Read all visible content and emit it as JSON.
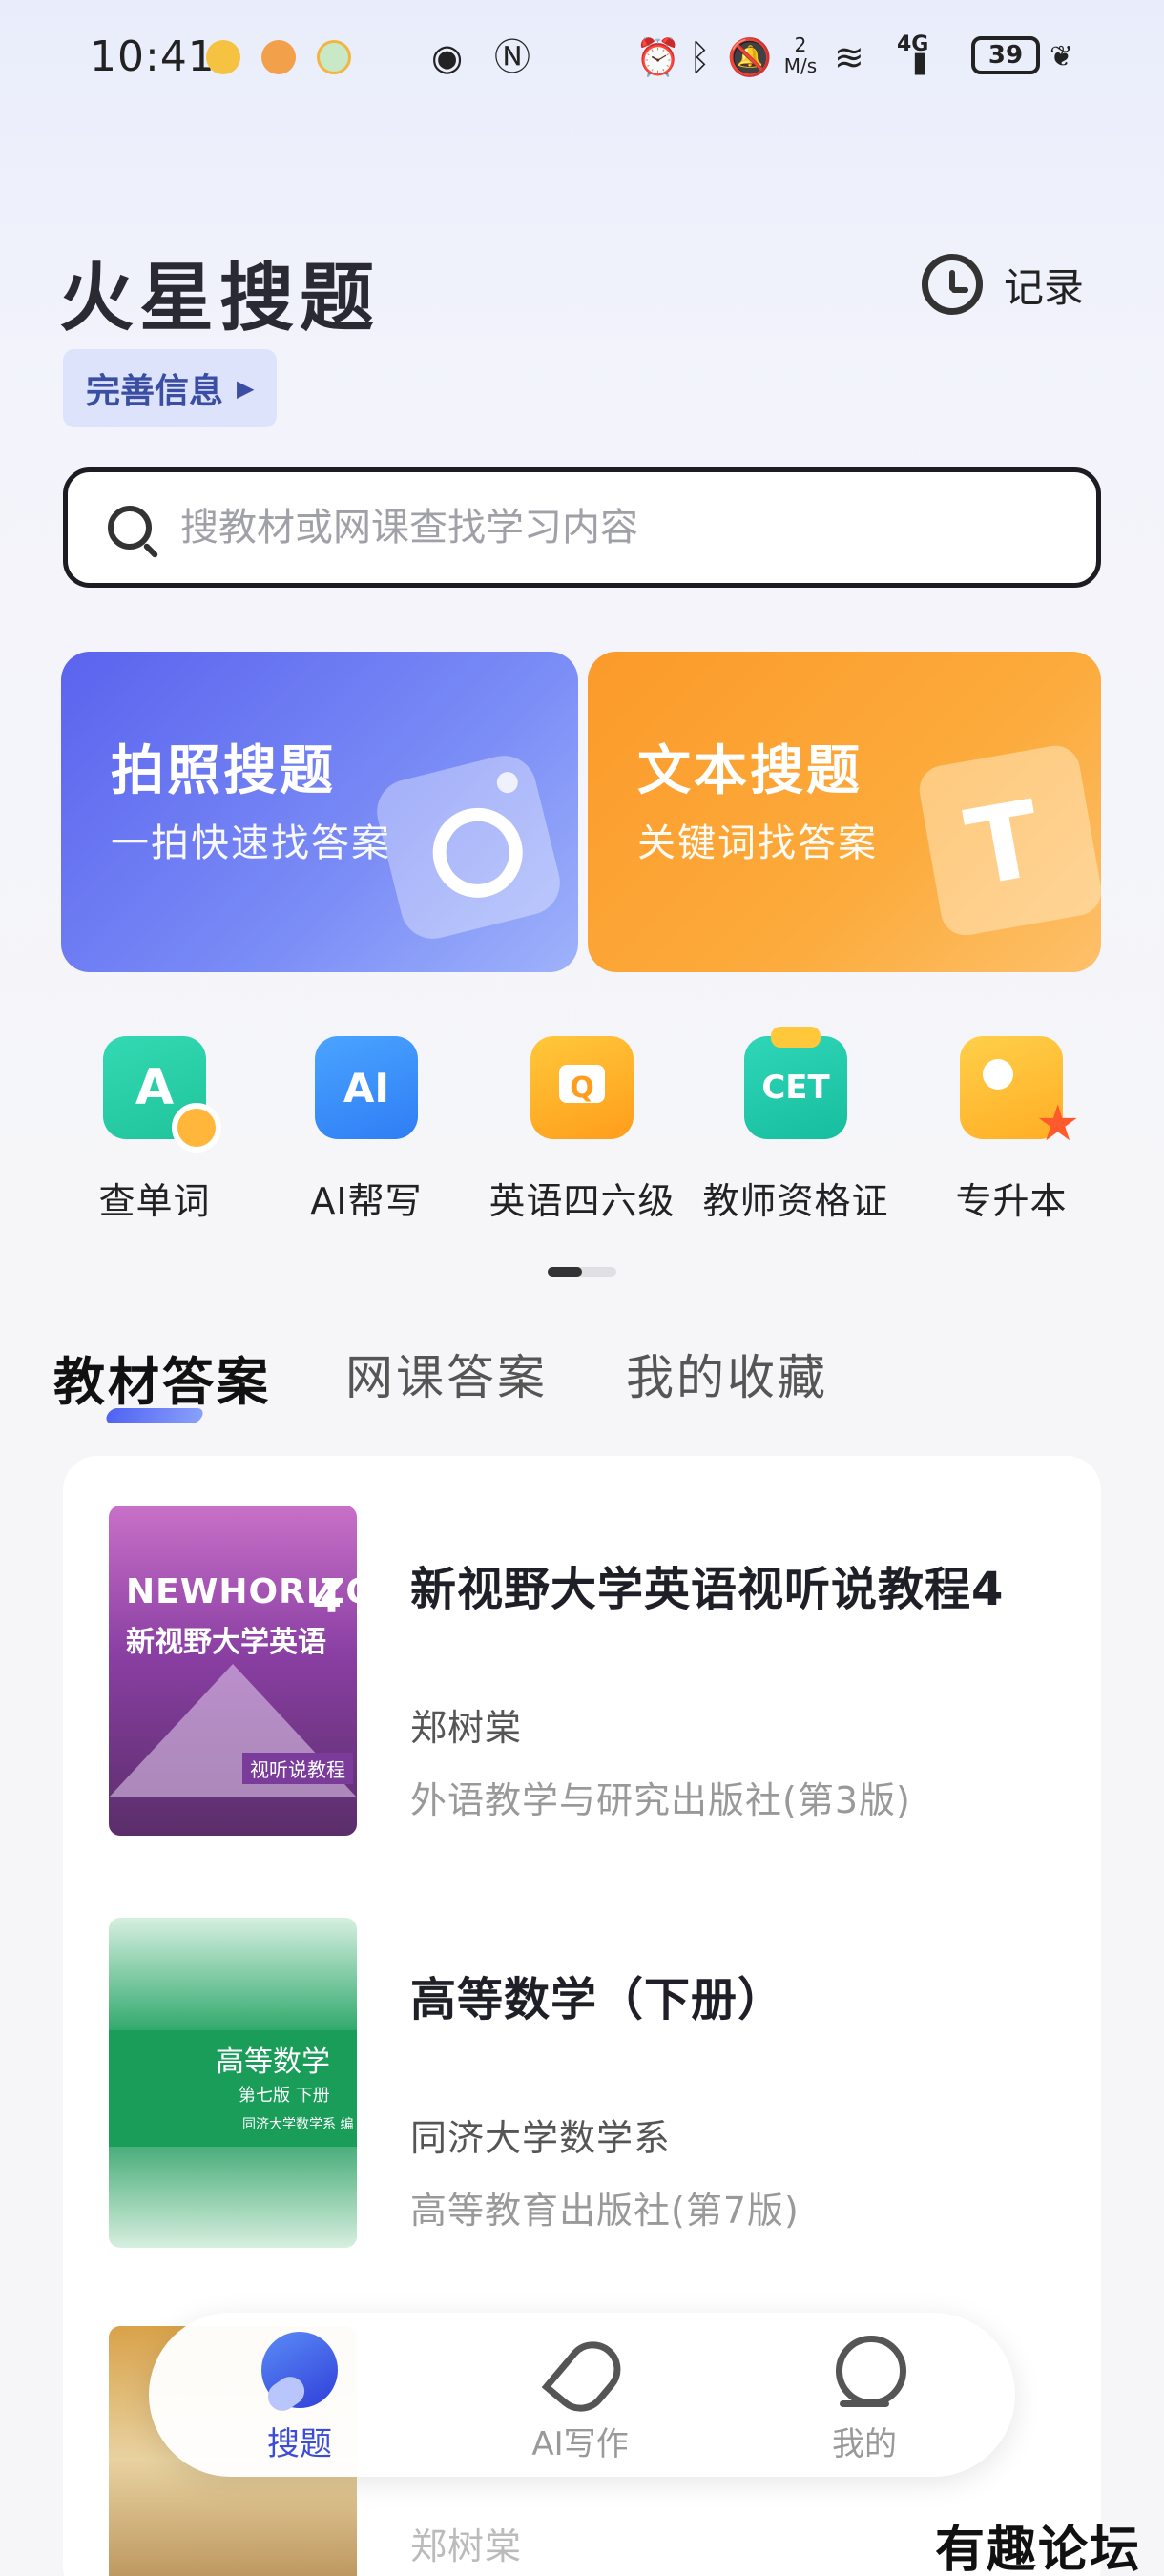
{
  "status_bar": {
    "time": "10:41",
    "net_speed": "2 M/s",
    "net_type": "4G",
    "battery": "39"
  },
  "header": {
    "title": "火星搜题",
    "history_label": "记录",
    "profile_prompt": "完善信息"
  },
  "search": {
    "placeholder": "搜教材或网课查找学习内容"
  },
  "feature_cards": [
    {
      "title": "拍照搜题",
      "subtitle": "一拍快速找答案"
    },
    {
      "title": "文本搜题",
      "subtitle": "关键词找答案"
    }
  ],
  "tools": [
    {
      "label": "查单词",
      "glyph": "A"
    },
    {
      "label": "AI帮写",
      "glyph": "AI"
    },
    {
      "label": "英语四六级",
      "glyph": "Q"
    },
    {
      "label": "教师资格证",
      "glyph": "CET"
    },
    {
      "label": "专升本",
      "glyph": ""
    }
  ],
  "tabs": [
    {
      "label": "教材答案"
    },
    {
      "label": "网课答案"
    },
    {
      "label": "我的收藏"
    }
  ],
  "books": [
    {
      "title": "新视野大学英语视听说教程4",
      "author": "郑树棠",
      "publisher": "外语教学与研究出版社(第3版)",
      "cover": {
        "brand": "NEWHORIZON",
        "cn": "新视野大学英语",
        "num": "4",
        "strip": "视听说教程"
      }
    },
    {
      "title": "高等数学（下册）",
      "author": "同济大学数学系",
      "publisher": "高等教育出版社(第7版)",
      "cover": {
        "cn": "高等数学",
        "edition": "第七版 下册",
        "editor": "同济大学数学系 编"
      }
    },
    {
      "title": "",
      "author": "郑树棠",
      "publisher": ""
    }
  ],
  "bottom_nav": [
    {
      "label": "搜题",
      "active": true
    },
    {
      "label": "AI写作",
      "active": false
    },
    {
      "label": "我的",
      "active": false
    }
  ],
  "watermark": "有趣论坛",
  "colors": {
    "accent": "#3b4dd6",
    "photo_card": "#5a63ee",
    "text_card": "#fb9a2a"
  }
}
